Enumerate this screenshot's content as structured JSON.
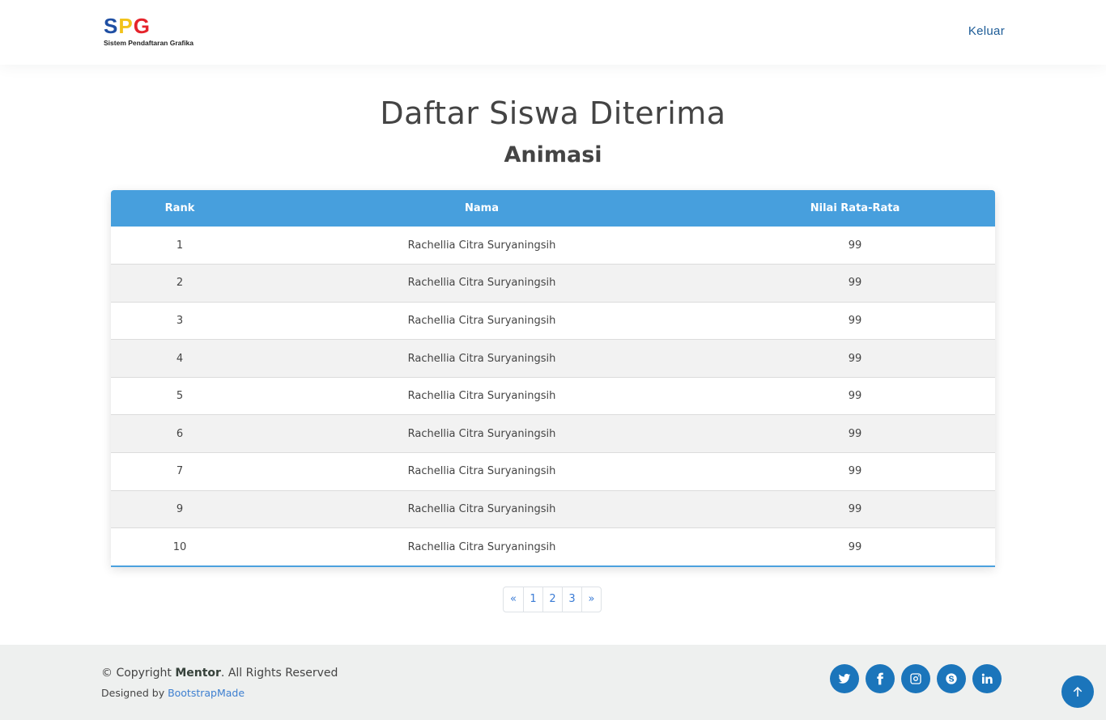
{
  "header": {
    "logo": {
      "s": "S",
      "p": "P",
      "g": "G",
      "subtitle": "Sistem Pendaftaran Grafika"
    },
    "logout_label": "Keluar"
  },
  "page": {
    "title": "Daftar Siswa Diterima",
    "subtitle": "Animasi"
  },
  "table": {
    "headers": [
      "Rank",
      "Nama",
      "Nilai Rata-Rata"
    ],
    "rows": [
      {
        "rank": "1",
        "nama": "Rachellia Citra Suryaningsih",
        "nilai": "99"
      },
      {
        "rank": "2",
        "nama": "Rachellia Citra Suryaningsih",
        "nilai": "99"
      },
      {
        "rank": "3",
        "nama": "Rachellia Citra Suryaningsih",
        "nilai": "99"
      },
      {
        "rank": "4",
        "nama": "Rachellia Citra Suryaningsih",
        "nilai": "99"
      },
      {
        "rank": "5",
        "nama": "Rachellia Citra Suryaningsih",
        "nilai": "99"
      },
      {
        "rank": "6",
        "nama": "Rachellia Citra Suryaningsih",
        "nilai": "99"
      },
      {
        "rank": "7",
        "nama": "Rachellia Citra Suryaningsih",
        "nilai": "99"
      },
      {
        "rank": "9",
        "nama": "Rachellia Citra Suryaningsih",
        "nilai": "99"
      },
      {
        "rank": "10",
        "nama": "Rachellia Citra Suryaningsih",
        "nilai": "99"
      }
    ]
  },
  "pagination": {
    "prev": "«",
    "pages": [
      "1",
      "2",
      "3"
    ],
    "next": "»"
  },
  "footer": {
    "copyright_prefix": "© Copyright ",
    "copyright_brand": "Mentor",
    "copyright_suffix": ". All Rights Reserved",
    "designed_by": "Designed by ",
    "designer": "BootstrapMade",
    "social_icons": [
      "twitter-icon",
      "facebook-icon",
      "instagram-icon",
      "skype-icon",
      "linkedin-icon"
    ]
  },
  "colors": {
    "table_header": "#479fdd",
    "accent": "#1b75bb",
    "logo_s": "#1f4fa3",
    "logo_p": "#f2c31a",
    "logo_g": "#e5232b"
  }
}
